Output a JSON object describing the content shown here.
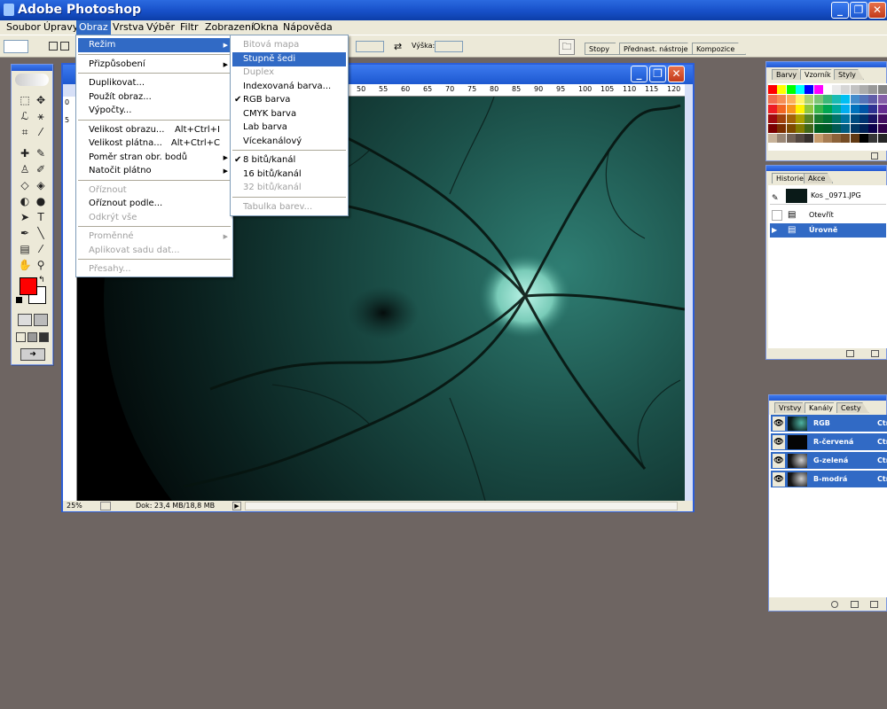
{
  "window": {
    "title": "Adobe Photoshop"
  },
  "menubar": [
    "Soubor",
    "Úpravy",
    "Obraz",
    "Vrstva",
    "Výběr",
    "Filtr",
    "Zobrazení",
    "Okna",
    "Nápověda"
  ],
  "optbar": {
    "height_label": "Výška:"
  },
  "palette_well": [
    "Stopy",
    "Přednast. nástroje",
    "Kompozice"
  ],
  "image_menu": {
    "items": [
      {
        "label": "Režim",
        "submenu": true,
        "highlighted": true
      },
      {
        "label": "Přizpůsobení",
        "submenu": true
      },
      {
        "label": "Duplikovat..."
      },
      {
        "label": "Použít obraz..."
      },
      {
        "label": "Výpočty..."
      },
      {
        "label": "Velikost obrazu...",
        "shortcut": "Alt+Ctrl+I"
      },
      {
        "label": "Velikost plátna...",
        "shortcut": "Alt+Ctrl+C"
      },
      {
        "label": "Poměr stran obr. bodů",
        "submenu": true
      },
      {
        "label": "Natočit plátno",
        "submenu": true
      },
      {
        "label": "Oříznout",
        "disabled": true
      },
      {
        "label": "Oříznout podle..."
      },
      {
        "label": "Odkrýt vše",
        "disabled": true
      },
      {
        "label": "Proměnné",
        "submenu": true,
        "disabled": true
      },
      {
        "label": "Aplikovat sadu dat...",
        "disabled": true
      },
      {
        "label": "Přesahy...",
        "disabled": true
      }
    ]
  },
  "mode_menu": {
    "items": [
      {
        "label": "Bitová mapa",
        "disabled": true
      },
      {
        "label": "Stupně šedi",
        "highlighted": true
      },
      {
        "label": "Duplex",
        "disabled": true
      },
      {
        "label": "Indexovaná barva..."
      },
      {
        "label": "RGB barva",
        "checked": true
      },
      {
        "label": "CMYK barva"
      },
      {
        "label": "Lab barva"
      },
      {
        "label": "Vícekanálový"
      },
      {
        "label": "8 bitů/kanál",
        "checked": true
      },
      {
        "label": "16 bitů/kanál"
      },
      {
        "label": "32 bitů/kanál",
        "disabled": true
      },
      {
        "label": "Tabulka barev...",
        "disabled": true
      }
    ]
  },
  "ruler_labels": [
    "50",
    "55",
    "60",
    "65",
    "70",
    "75",
    "80",
    "85",
    "90",
    "95",
    "100",
    "105",
    "110",
    "115",
    "120"
  ],
  "statusbar": {
    "zoom": "25%",
    "doc": "Dok: 23,4 MB/18,8 MB"
  },
  "color_panel": {
    "tabs": [
      "Barvy",
      "Vzorník",
      "Styly"
    ],
    "active": "Vzorník"
  },
  "history_panel": {
    "tabs": [
      "Historie",
      "Akce"
    ],
    "snapshot": "Kos _0971.JPG",
    "steps": [
      "Otevřít",
      "Úrovně"
    ]
  },
  "channels_panel": {
    "tabs": [
      "Vrstvy",
      "Kanály",
      "Cesty"
    ],
    "channels": [
      {
        "name": "RGB",
        "shortcut": "Ctrl"
      },
      {
        "name": "R-červená",
        "shortcut": "Ctrl"
      },
      {
        "name": "G-zelená",
        "shortcut": "Ctrl"
      },
      {
        "name": "B-modrá",
        "shortcut": "Ctrl"
      }
    ]
  },
  "colors": {
    "foreground": "#ff0000",
    "background": "#ffffff",
    "accent": "#316ac5",
    "desktop": "#6e6562"
  }
}
